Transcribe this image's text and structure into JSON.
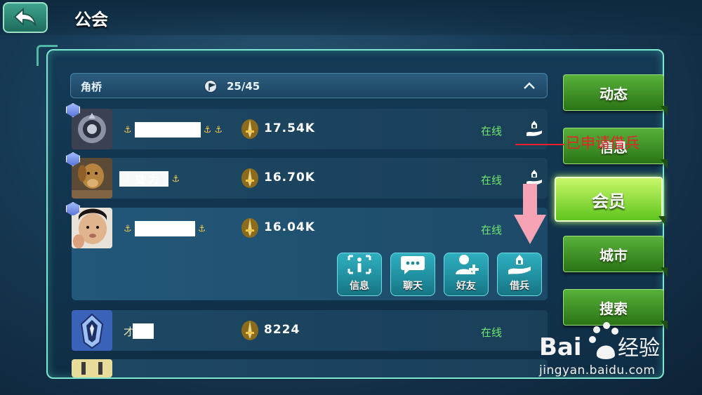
{
  "page": {
    "title": "公会"
  },
  "guild": {
    "name": "角桥",
    "member_count": "25/45"
  },
  "members": [
    {
      "power": "17.54K",
      "status": "在线"
    },
    {
      "name_visible": "皇 力",
      "power": "16.70K",
      "status": "在线"
    },
    {
      "power": "16.04K",
      "status": "在线"
    },
    {
      "name_visible": "才",
      "power": "8224",
      "status": "在线"
    }
  ],
  "actions": [
    {
      "label": "信息",
      "icon": "info-icon"
    },
    {
      "label": "聊天",
      "icon": "chat-bubble-icon"
    },
    {
      "label": "好友",
      "icon": "add-friend-icon"
    },
    {
      "label": "借兵",
      "icon": "lend-troops-icon"
    }
  ],
  "side_tabs": [
    {
      "label": "动态"
    },
    {
      "label": "信息"
    },
    {
      "label": "会员",
      "active": true
    },
    {
      "label": "城市"
    },
    {
      "label": "搜索"
    }
  ],
  "annotation": {
    "text": "已申请借兵",
    "color": "#e8222b"
  },
  "watermark": {
    "brand": "Bai 经验",
    "url": "jingyan.baidu.com"
  },
  "colors": {
    "online": "#6ee86e",
    "tab_green": "#4ea32e",
    "frame_accent": "#7ee7d0"
  }
}
